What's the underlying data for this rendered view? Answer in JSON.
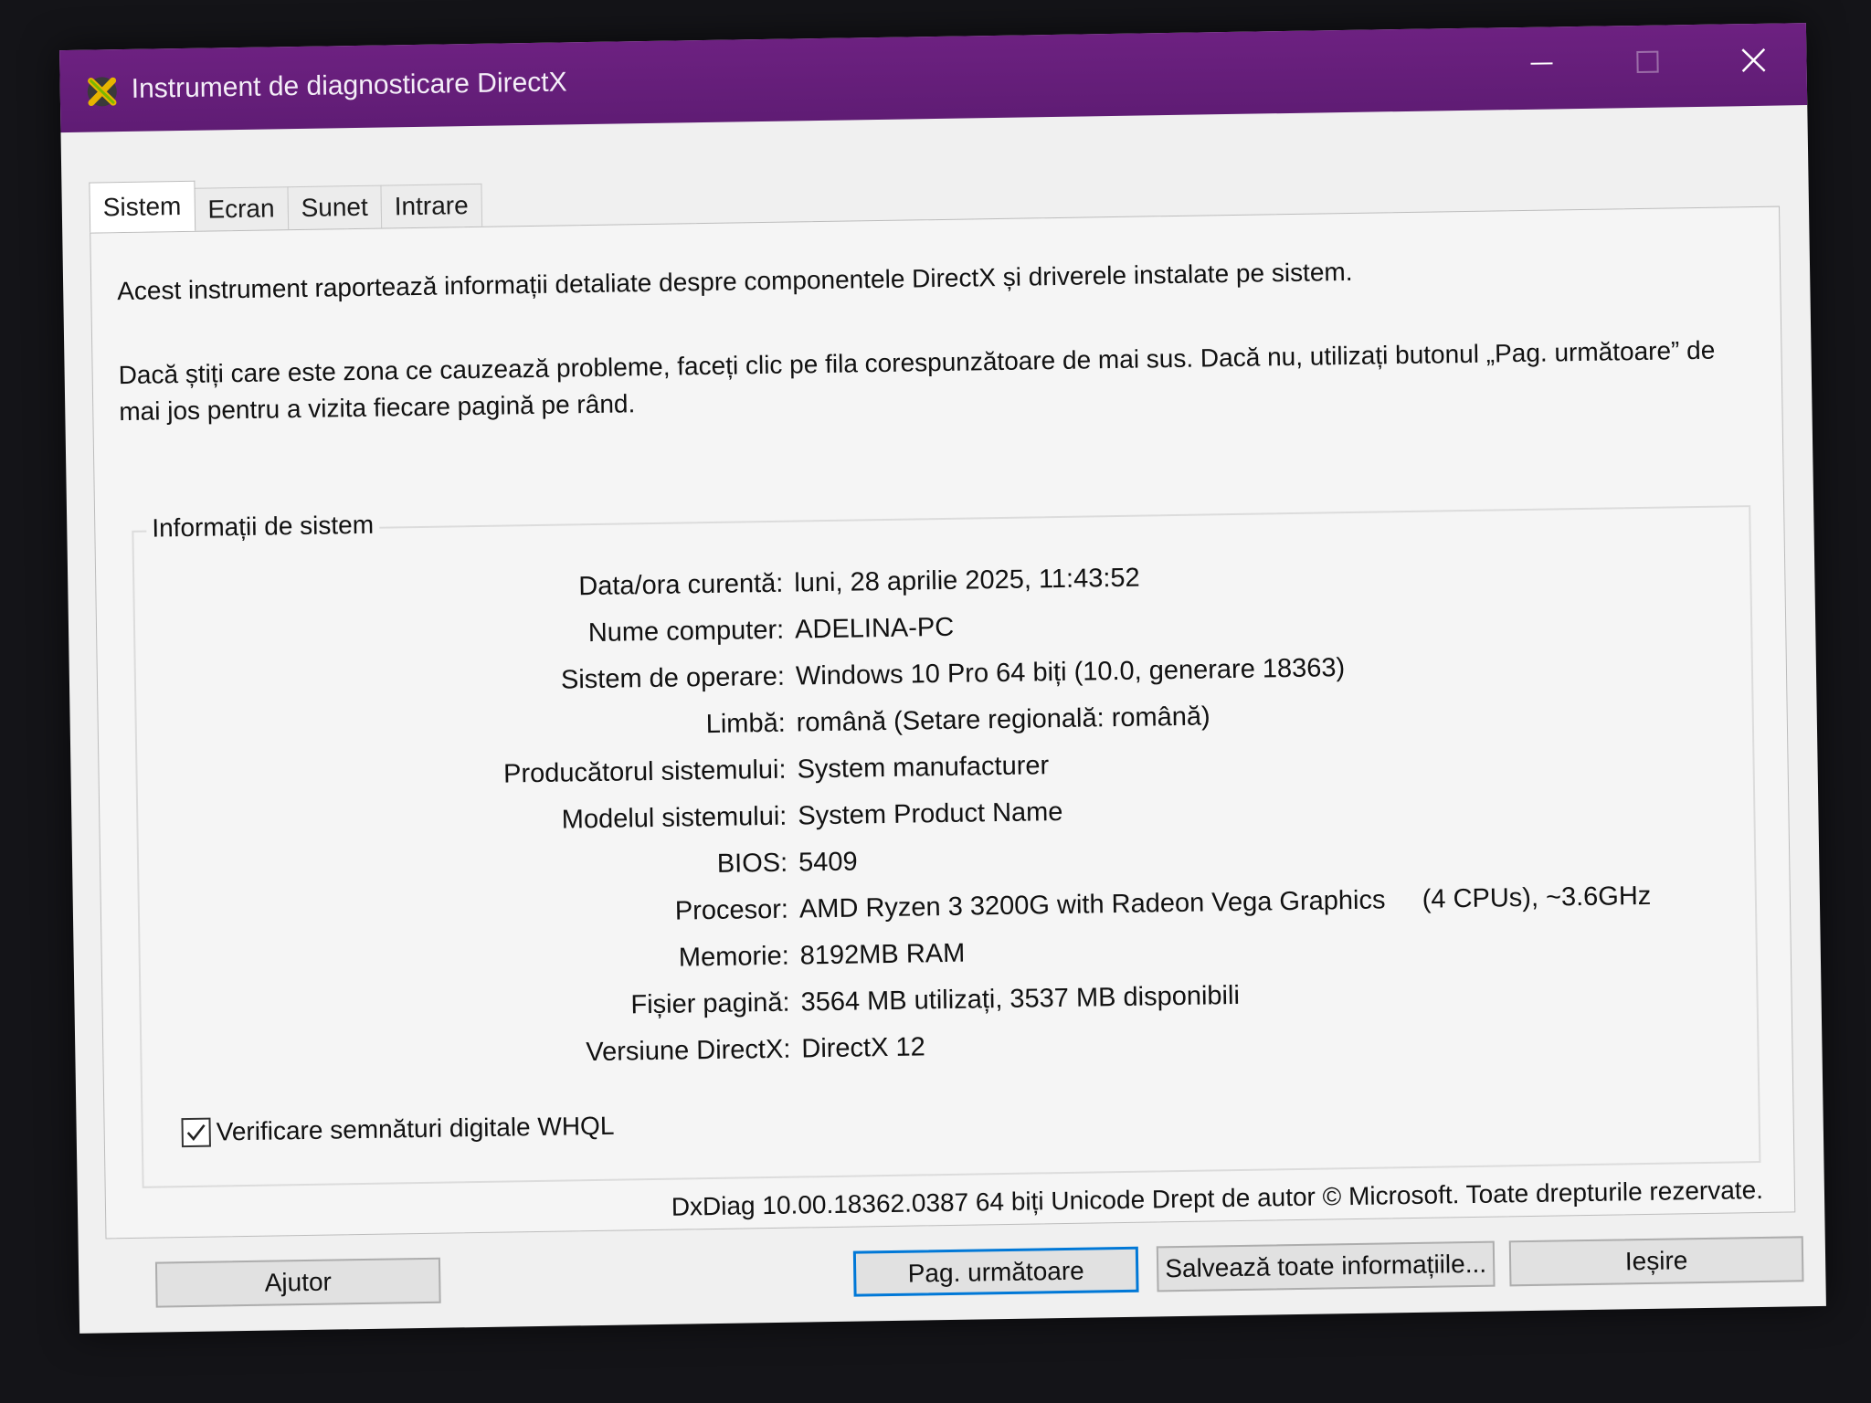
{
  "window": {
    "title": "Instrument de diagnosticare DirectX"
  },
  "tabs": [
    {
      "label": "Sistem",
      "active": true
    },
    {
      "label": "Ecran",
      "active": false
    },
    {
      "label": "Sunet",
      "active": false
    },
    {
      "label": "Intrare",
      "active": false
    }
  ],
  "intro": {
    "line1": "Acest instrument raportează informații detaliate despre componentele DirectX și driverele instalate pe sistem.",
    "line2": "Dacă știți care este zona ce cauzează probleme, faceți clic pe fila corespunzătoare de mai sus. Dacă nu, utilizați butonul „Pag. următoare” de mai jos pentru a vizita fiecare pagină pe rând."
  },
  "system_info": {
    "group_title": "Informații de sistem",
    "rows": [
      {
        "label": "Data/ora curentă:",
        "value": "luni, 28 aprilie 2025, 11:43:52"
      },
      {
        "label": "Nume computer:",
        "value": "ADELINA-PC"
      },
      {
        "label": "Sistem de operare:",
        "value": "Windows 10 Pro 64 biți (10.0, generare 18363)"
      },
      {
        "label": "Limbă:",
        "value": "română (Setare regională: română)"
      },
      {
        "label": "Producătorul sistemului:",
        "value": "System manufacturer"
      },
      {
        "label": "Modelul sistemului:",
        "value": "System Product Name"
      },
      {
        "label": "BIOS:",
        "value": "5409"
      },
      {
        "label": "Procesor:",
        "value": "AMD Ryzen 3 3200G with Radeon Vega Graphics     (4 CPUs), ~3.6GHz"
      },
      {
        "label": "Memorie:",
        "value": "8192MB RAM"
      },
      {
        "label": "Fișier pagină:",
        "value": "3564 MB utilizați, 3537 MB disponibili"
      },
      {
        "label": "Versiune DirectX:",
        "value": "DirectX 12"
      }
    ]
  },
  "whql": {
    "label": "Verificare semnături digitale WHQL",
    "checked": true
  },
  "copyright": "DxDiag 10.00.18362.0387 64 biți Unicode  Drept de autor © Microsoft. Toate drepturile rezervate.",
  "buttons": {
    "help": "Ajutor",
    "next": "Pag. următoare",
    "save": "Salvează toate informațiile...",
    "exit": "Ieșire"
  },
  "colors": {
    "titlebar": "#6d2181",
    "focus_border": "#0078d7"
  }
}
